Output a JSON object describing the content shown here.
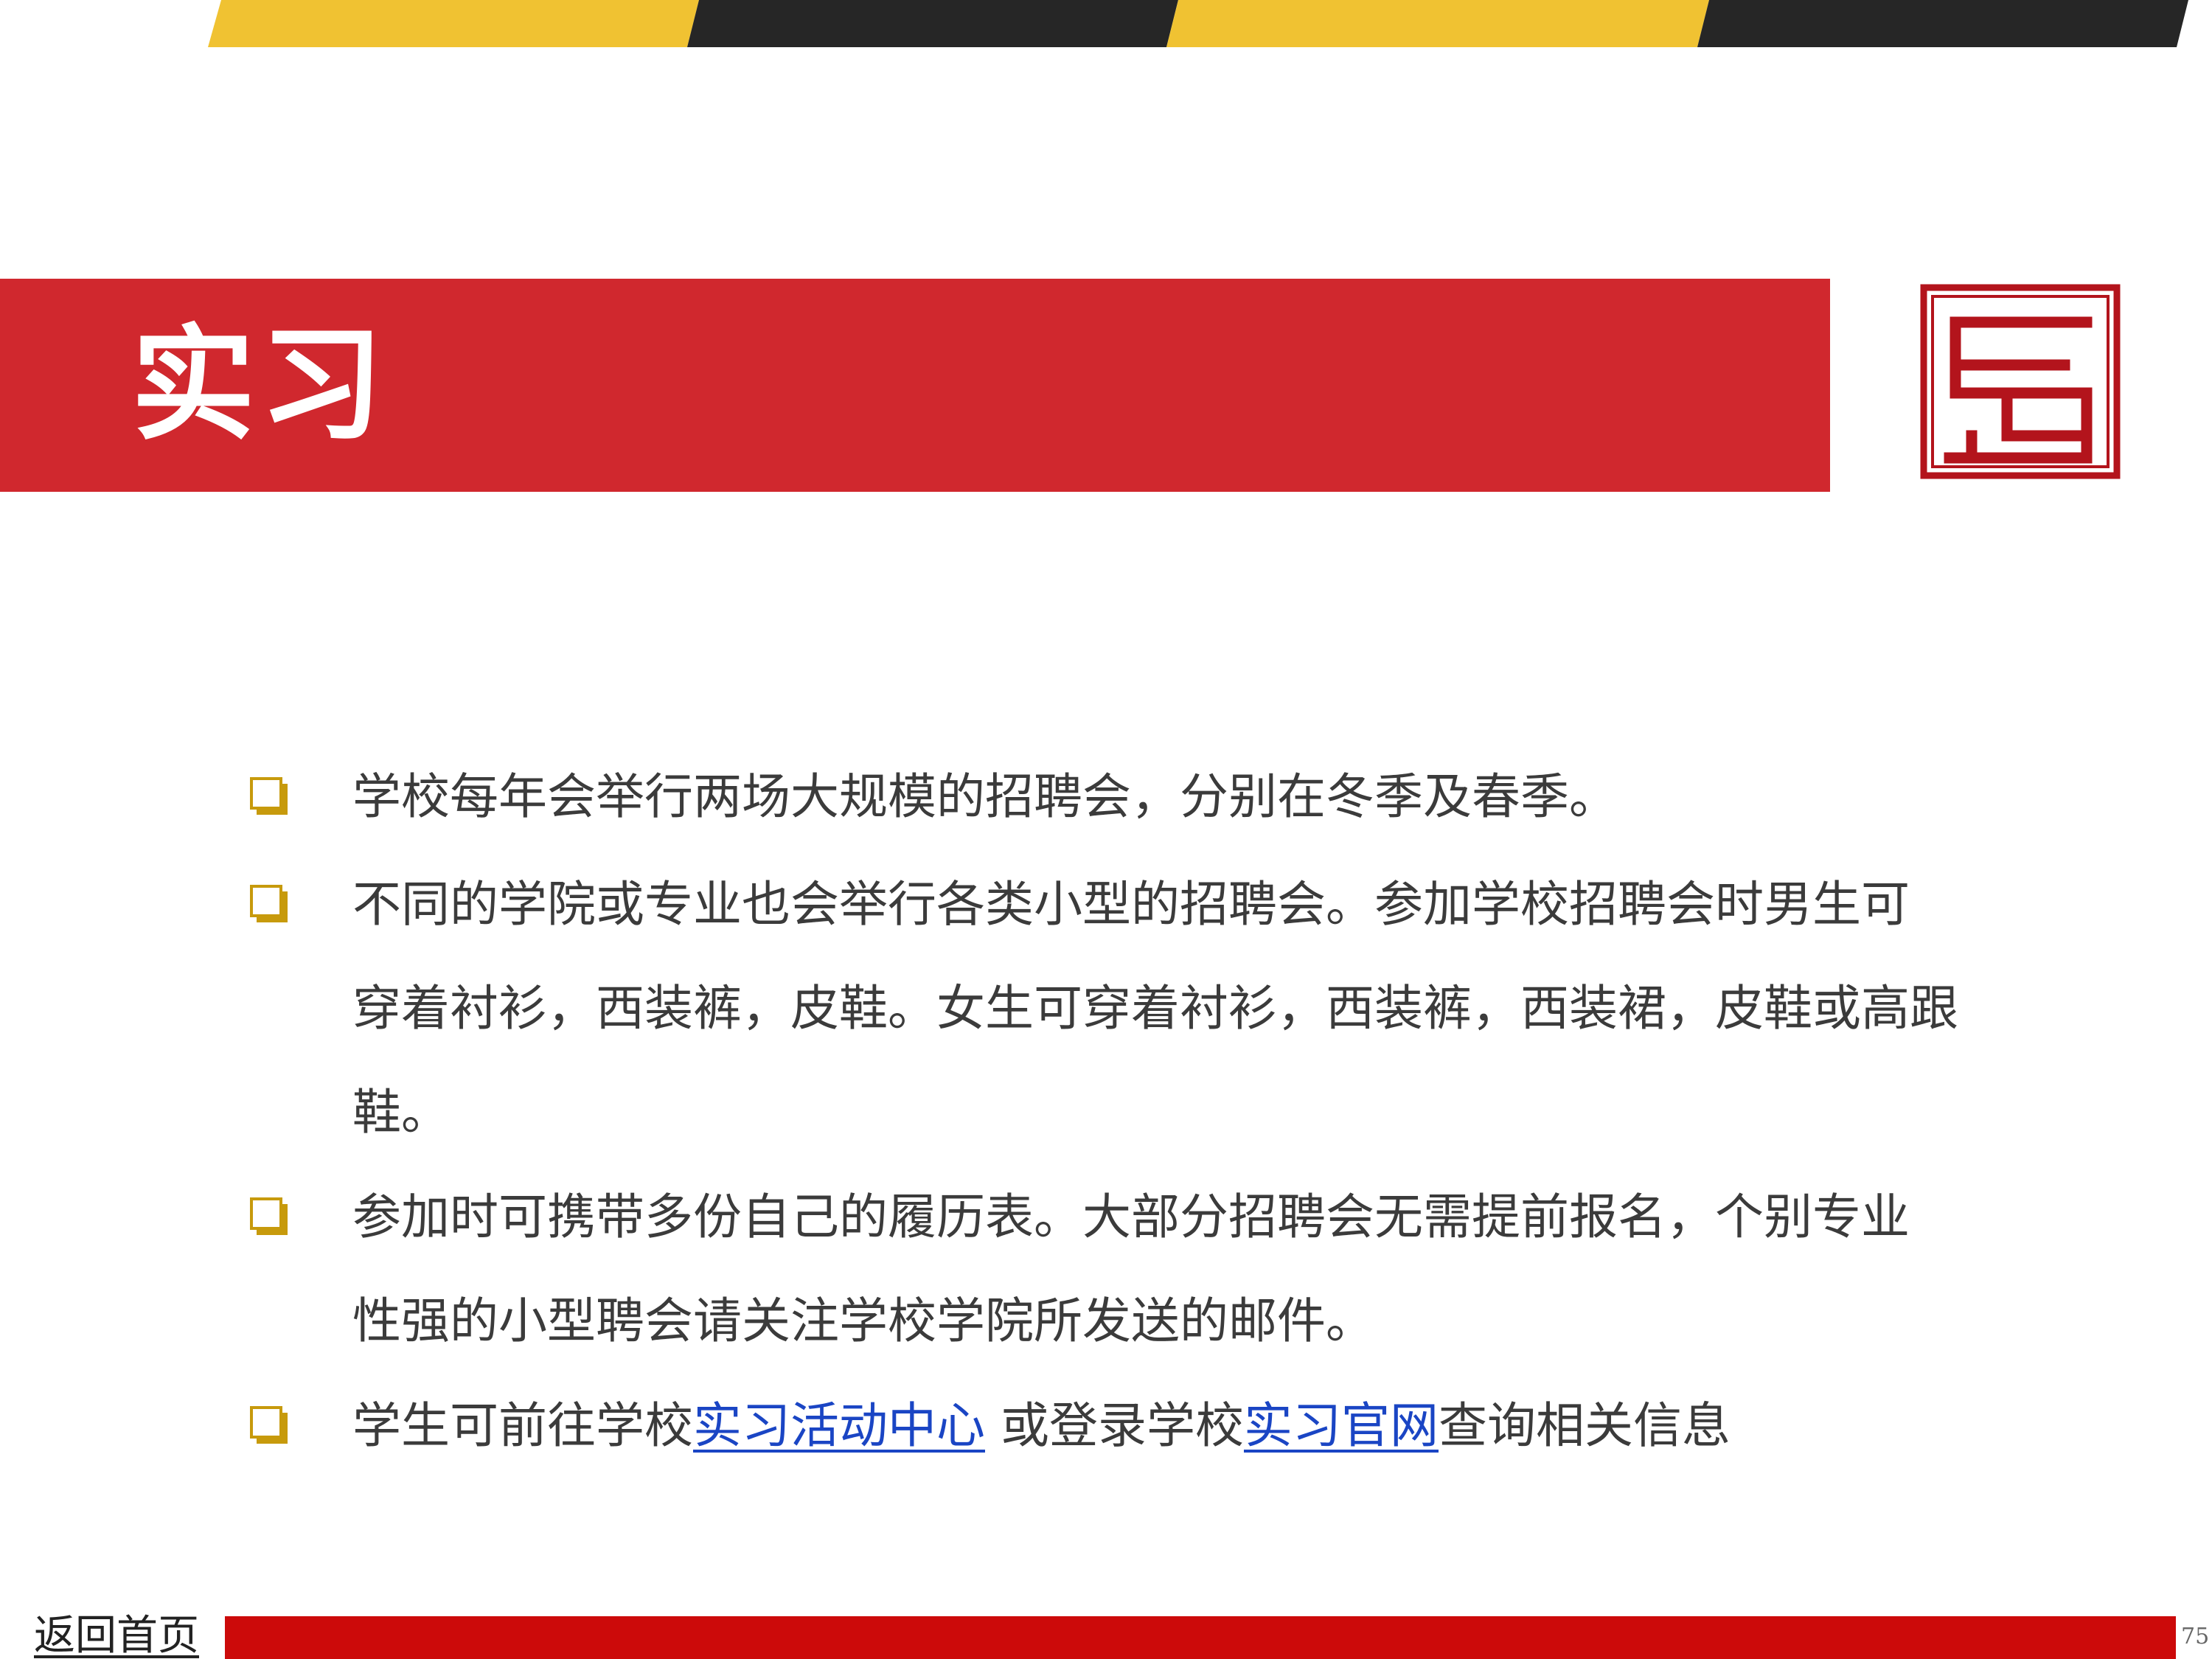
{
  "slide": {
    "title": "实习",
    "page_number": "75",
    "home_link": "返回首页"
  },
  "colors": {
    "banner_red": "#d0282e",
    "stripe_yellow": "#f0c232",
    "stripe_black": "#262626",
    "footer_red": "#cc0a0a",
    "link_blue": "#1a45c4",
    "bullet_gold": "#c79a0c",
    "seal_red": "#b3141c"
  },
  "icons": {
    "bullet": "checkbox-bullet-icon",
    "seal": "seal-logo-icon"
  },
  "bullets": [
    {
      "lines": [
        "学校每年会举行两场大规模的招聘会，分别在冬季及春季。"
      ]
    },
    {
      "lines": [
        "不同的学院或专业也会举行各类小型的招聘会。参加学校招聘会时男生可",
        "穿着衬衫，西装裤，皮鞋。女生可穿着衬衫，西装裤，西装裙，皮鞋或高跟",
        "鞋。"
      ]
    },
    {
      "lines": [
        "参加时可携带多份自己的履历表。大部分招聘会无需提前报名，个别专业",
        "性强的小型聘会请关注学校学院所发送的邮件。"
      ]
    },
    {
      "parts": {
        "prefix": "学生可前往学校",
        "link1": "实习活动中心",
        "middle": " 或登录学校",
        "link2": "实习官网",
        "suffix": "查询相关信息"
      }
    }
  ]
}
